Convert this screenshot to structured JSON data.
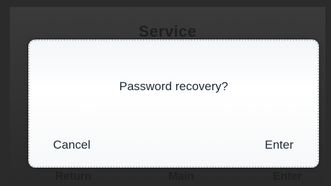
{
  "background_screen": {
    "title": "Service",
    "softkeys": {
      "left": "Return",
      "middle": "Main",
      "right": "Enter"
    }
  },
  "dialog": {
    "message": "Password recovery?",
    "cancel_label": "Cancel",
    "enter_label": "Enter"
  },
  "colors": {
    "screen_background": "#333333",
    "dialog_background": "#ffffff",
    "text": "#1d2a38"
  }
}
